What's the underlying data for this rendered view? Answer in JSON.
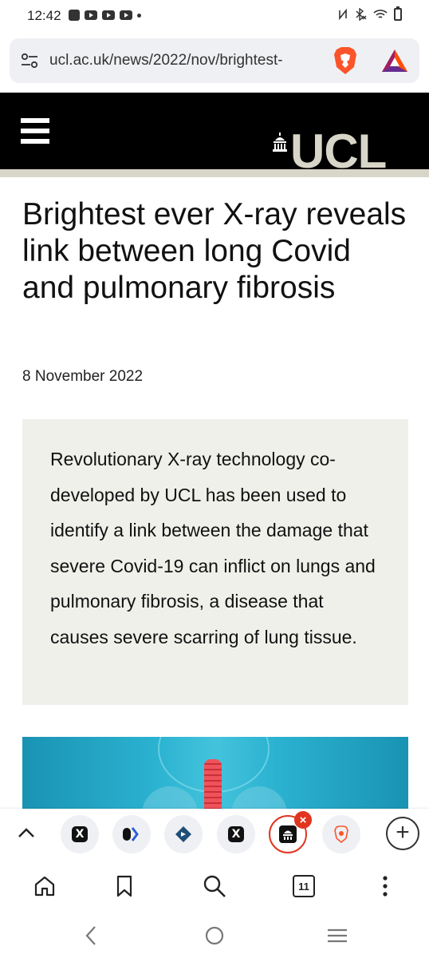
{
  "status_bar": {
    "time": "12:42",
    "notification_icons": [
      "alert-icon",
      "youtube-icon",
      "youtube-icon",
      "youtube-icon",
      "more-dot-icon"
    ],
    "system_icons": [
      "nfc-icon",
      "bluetooth-mute-icon",
      "wifi-icon",
      "battery-icon"
    ]
  },
  "address_bar": {
    "url": "ucl.ac.uk/news/2022/nov/brightest-",
    "left_icon": "site-settings-icon",
    "right_icons": [
      "brave-shields-icon",
      "brave-rewards-icon"
    ]
  },
  "site_header": {
    "logo_text": "UCL",
    "menu_icon": "hamburger-menu-icon"
  },
  "article": {
    "title": "Brightest ever X-ray reveals link between long Covid and pulmonary fibrosis",
    "date": "8 November 2022",
    "summary": "Revolutionary X-ray technology co-developed by UCL has been used to identify a link between the damage that severe Covid-19 can inflict on lungs and pulmonary fibrosis, a disease that causes severe scarring of lung tissue."
  },
  "tab_strip": {
    "tabs": [
      {
        "icon": "x-logo-icon",
        "glyph": "X"
      },
      {
        "icon": "tab-site-icon-2",
        "glyph": ""
      },
      {
        "icon": "tab-site-icon-3",
        "glyph": ""
      },
      {
        "icon": "x-logo-icon",
        "glyph": "X"
      },
      {
        "icon": "ucl-tab-icon",
        "glyph": "",
        "active": true
      },
      {
        "icon": "brave-tab-icon",
        "glyph": ""
      }
    ],
    "new_tab_symbol": "+"
  },
  "bottom_toolbar": {
    "tab_count": "11",
    "icons": [
      "home-icon",
      "bookmark-icon",
      "search-icon",
      "tab-count-icon",
      "more-menu-icon"
    ]
  },
  "colors": {
    "ucl_header_bg": "#000000",
    "ucl_accent": "#d8d6c8",
    "summary_bg": "#f0f0eb",
    "active_tab_red": "#e0341f"
  }
}
